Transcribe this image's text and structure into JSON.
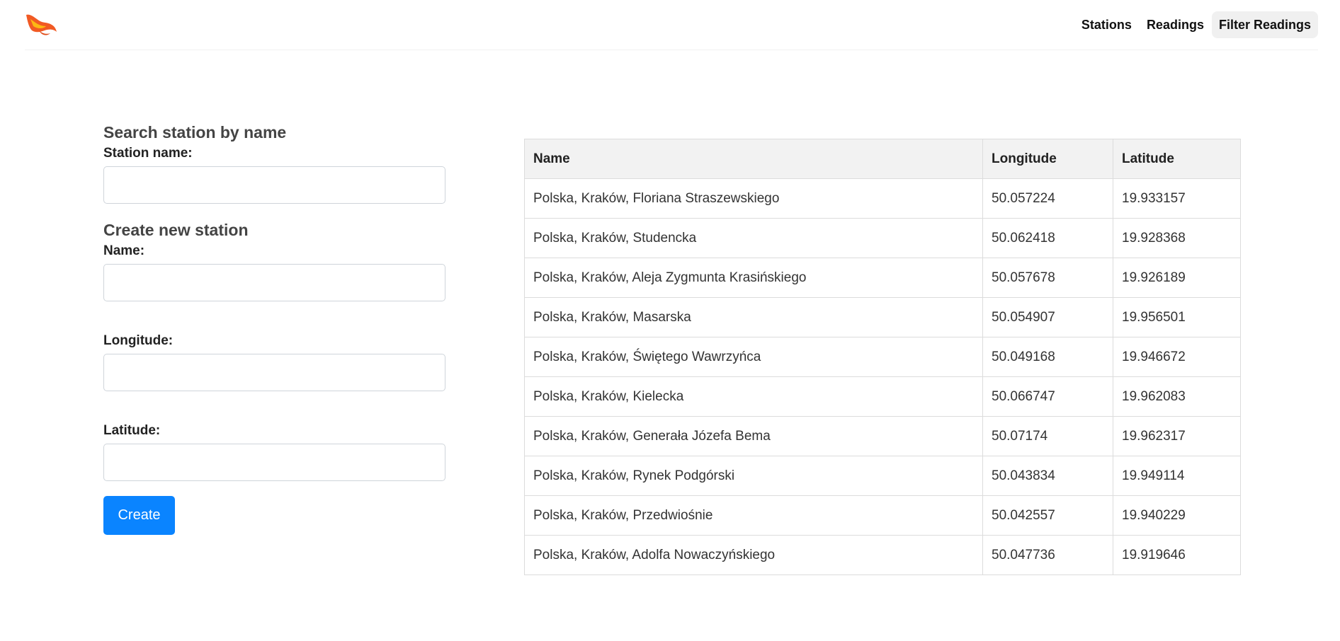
{
  "header": {
    "logo_icon": "phoenix-flame-icon",
    "nav": [
      {
        "label": "Stations"
      },
      {
        "label": "Readings"
      },
      {
        "label": "Filter Readings"
      }
    ]
  },
  "search": {
    "title": "Search station by name",
    "label": "Station name:",
    "value": ""
  },
  "create": {
    "title": "Create new station",
    "name_label": "Name:",
    "longitude_label": "Longitude:",
    "latitude_label": "Latitude:",
    "button_label": "Create",
    "button_color": "#0a84ff"
  },
  "table": {
    "headers": [
      "Name",
      "Longitude",
      "Latitude"
    ],
    "rows": [
      [
        "Polska, Kraków, Floriana Straszewskiego",
        "50.057224",
        "19.933157"
      ],
      [
        "Polska, Kraków, Studencka",
        "50.062418",
        "19.928368"
      ],
      [
        "Polska, Kraków, Aleja Zygmunta Krasińskiego",
        "50.057678",
        "19.926189"
      ],
      [
        "Polska, Kraków, Masarska",
        "50.054907",
        "19.956501"
      ],
      [
        "Polska, Kraków, Świętego Wawrzyńca",
        "50.049168",
        "19.946672"
      ],
      [
        "Polska, Kraków, Kielecka",
        "50.066747",
        "19.962083"
      ],
      [
        "Polska, Kraków, Generała Józefa Bema",
        "50.07174",
        "19.962317"
      ],
      [
        "Polska, Kraków, Rynek Podgórski",
        "50.043834",
        "19.949114"
      ],
      [
        "Polska, Kraków, Przedwiośnie",
        "50.042557",
        "19.940229"
      ],
      [
        "Polska, Kraków, Adolfa Nowaczyńskiego",
        "50.047736",
        "19.919646"
      ]
    ]
  }
}
